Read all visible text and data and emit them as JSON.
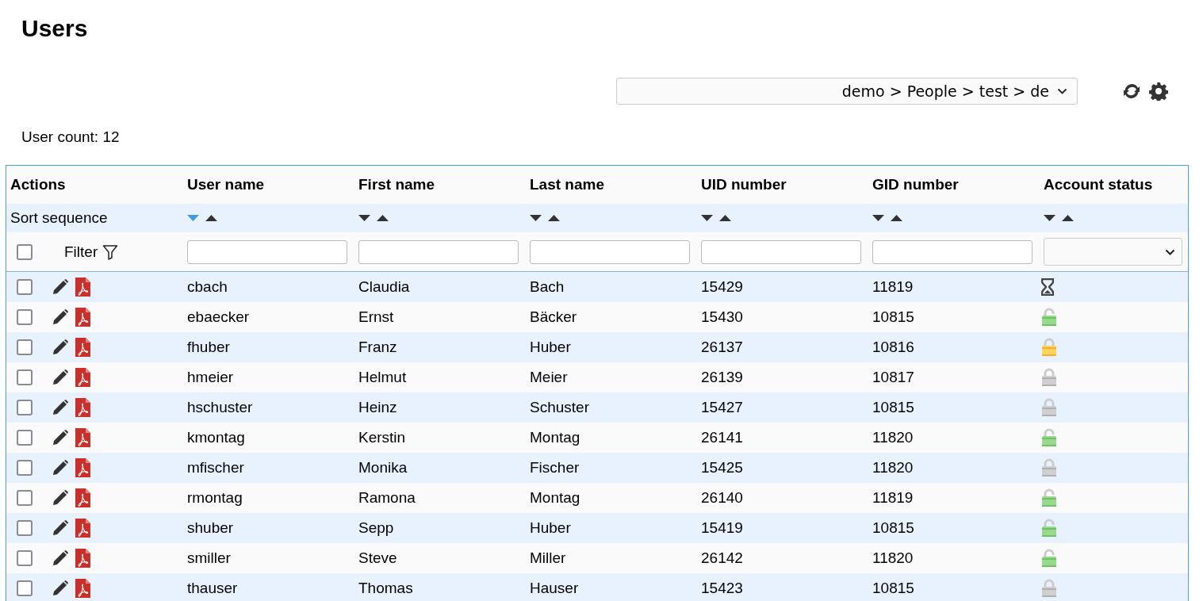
{
  "page": {
    "title": "Users"
  },
  "toolbar": {
    "location_select": {
      "value": "demo > People > test > de"
    }
  },
  "user_count": "User count: 12",
  "table": {
    "columns": [
      {
        "label": "Actions"
      },
      {
        "label": "User name",
        "sort_descending": true
      },
      {
        "label": "First name",
        "sort_descending": false
      },
      {
        "label": "Last name",
        "sort_descending": false
      },
      {
        "label": "UID number",
        "sort_descending": false
      },
      {
        "label": "GID number",
        "sort_descending": false
      },
      {
        "label": "Account status",
        "sort_descending": false
      }
    ],
    "sort_label": "Sort sequence",
    "filter": {
      "label": "Filter",
      "select_all_checked": false
    },
    "rows": [
      {
        "checked": false,
        "user_name": "cbach",
        "first_name": "Claudia",
        "last_name": "Bach",
        "uid": "15429",
        "gid": "11819",
        "status": {
          "kind": "expired"
        }
      },
      {
        "checked": false,
        "user_name": "ebaecker",
        "first_name": "Ernst",
        "last_name": "Bäcker",
        "uid": "15430",
        "gid": "10815",
        "status": {
          "kind": "unlocked"
        }
      },
      {
        "checked": false,
        "user_name": "fhuber",
        "first_name": "Franz",
        "last_name": "Huber",
        "uid": "26137",
        "gid": "10816",
        "status": {
          "kind": "partial"
        }
      },
      {
        "checked": false,
        "user_name": "hmeier",
        "first_name": "Helmut",
        "last_name": "Meier",
        "uid": "26139",
        "gid": "10817",
        "status": {
          "kind": "locked"
        }
      },
      {
        "checked": false,
        "user_name": "hschuster",
        "first_name": "Heinz",
        "last_name": "Schuster",
        "uid": "15427",
        "gid": "10815",
        "status": {
          "kind": "locked"
        }
      },
      {
        "checked": false,
        "user_name": "kmontag",
        "first_name": "Kerstin",
        "last_name": "Montag",
        "uid": "26141",
        "gid": "11820",
        "status": {
          "kind": "unlocked"
        }
      },
      {
        "checked": false,
        "user_name": "mfischer",
        "first_name": "Monika",
        "last_name": "Fischer",
        "uid": "15425",
        "gid": "11820",
        "status": {
          "kind": "locked"
        }
      },
      {
        "checked": false,
        "user_name": "rmontag",
        "first_name": "Ramona",
        "last_name": "Montag",
        "uid": "26140",
        "gid": "11819",
        "status": {
          "kind": "unlocked"
        }
      },
      {
        "checked": false,
        "user_name": "shuber",
        "first_name": "Sepp",
        "last_name": "Huber",
        "uid": "15419",
        "gid": "10815",
        "status": {
          "kind": "unlocked"
        }
      },
      {
        "checked": false,
        "user_name": "smiller",
        "first_name": "Steve",
        "last_name": "Miller",
        "uid": "26142",
        "gid": "11820",
        "status": {
          "kind": "unlocked"
        }
      },
      {
        "checked": false,
        "user_name": "thauser",
        "first_name": "Thomas",
        "last_name": "Hauser",
        "uid": "15423",
        "gid": "10815",
        "status": {
          "kind": "locked"
        }
      }
    ]
  }
}
